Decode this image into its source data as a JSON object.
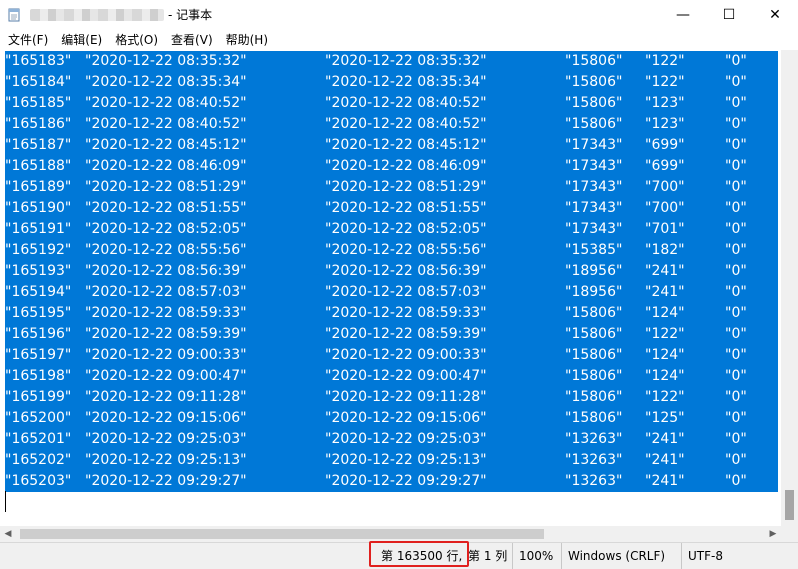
{
  "window": {
    "title": "- 记事本",
    "minimize_glyph": "—",
    "maximize_glyph": "☐",
    "close_glyph": "✕"
  },
  "menu": [
    {
      "label": "文件(F)"
    },
    {
      "label": "编辑(E)"
    },
    {
      "label": "格式(O)"
    },
    {
      "label": "查看(V)"
    },
    {
      "label": "帮助(H)"
    }
  ],
  "rows": [
    [
      "\"165183\"",
      "\"2020-12-22 08:35:32\"",
      "\"2020-12-22 08:35:32\"",
      "\"15806\"",
      "\"122\"",
      "\"0\""
    ],
    [
      "\"165184\"",
      "\"2020-12-22 08:35:34\"",
      "\"2020-12-22 08:35:34\"",
      "\"15806\"",
      "\"122\"",
      "\"0\""
    ],
    [
      "\"165185\"",
      "\"2020-12-22 08:40:52\"",
      "\"2020-12-22 08:40:52\"",
      "\"15806\"",
      "\"123\"",
      "\"0\""
    ],
    [
      "\"165186\"",
      "\"2020-12-22 08:40:52\"",
      "\"2020-12-22 08:40:52\"",
      "\"15806\"",
      "\"123\"",
      "\"0\""
    ],
    [
      "\"165187\"",
      "\"2020-12-22 08:45:12\"",
      "\"2020-12-22 08:45:12\"",
      "\"17343\"",
      "\"699\"",
      "\"0\""
    ],
    [
      "\"165188\"",
      "\"2020-12-22 08:46:09\"",
      "\"2020-12-22 08:46:09\"",
      "\"17343\"",
      "\"699\"",
      "\"0\""
    ],
    [
      "\"165189\"",
      "\"2020-12-22 08:51:29\"",
      "\"2020-12-22 08:51:29\"",
      "\"17343\"",
      "\"700\"",
      "\"0\""
    ],
    [
      "\"165190\"",
      "\"2020-12-22 08:51:55\"",
      "\"2020-12-22 08:51:55\"",
      "\"17343\"",
      "\"700\"",
      "\"0\""
    ],
    [
      "\"165191\"",
      "\"2020-12-22 08:52:05\"",
      "\"2020-12-22 08:52:05\"",
      "\"17343\"",
      "\"701\"",
      "\"0\""
    ],
    [
      "\"165192\"",
      "\"2020-12-22 08:55:56\"",
      "\"2020-12-22 08:55:56\"",
      "\"15385\"",
      "\"182\"",
      "\"0\""
    ],
    [
      "\"165193\"",
      "\"2020-12-22 08:56:39\"",
      "\"2020-12-22 08:56:39\"",
      "\"18956\"",
      "\"241\"",
      "\"0\""
    ],
    [
      "\"165194\"",
      "\"2020-12-22 08:57:03\"",
      "\"2020-12-22 08:57:03\"",
      "\"18956\"",
      "\"241\"",
      "\"0\""
    ],
    [
      "\"165195\"",
      "\"2020-12-22 08:59:33\"",
      "\"2020-12-22 08:59:33\"",
      "\"15806\"",
      "\"124\"",
      "\"0\""
    ],
    [
      "\"165196\"",
      "\"2020-12-22 08:59:39\"",
      "\"2020-12-22 08:59:39\"",
      "\"15806\"",
      "\"122\"",
      "\"0\""
    ],
    [
      "\"165197\"",
      "\"2020-12-22 09:00:33\"",
      "\"2020-12-22 09:00:33\"",
      "\"15806\"",
      "\"124\"",
      "\"0\""
    ],
    [
      "\"165198\"",
      "\"2020-12-22 09:00:47\"",
      "\"2020-12-22 09:00:47\"",
      "\"15806\"",
      "\"124\"",
      "\"0\""
    ],
    [
      "\"165199\"",
      "\"2020-12-22 09:11:28\"",
      "\"2020-12-22 09:11:28\"",
      "\"15806\"",
      "\"122\"",
      "\"0\""
    ],
    [
      "\"165200\"",
      "\"2020-12-22 09:15:06\"",
      "\"2020-12-22 09:15:06\"",
      "\"15806\"",
      "\"125\"",
      "\"0\""
    ],
    [
      "\"165201\"",
      "\"2020-12-22 09:25:03\"",
      "\"2020-12-22 09:25:03\"",
      "\"13263\"",
      "\"241\"",
      "\"0\""
    ],
    [
      "\"165202\"",
      "\"2020-12-22 09:25:13\"",
      "\"2020-12-22 09:25:13\"",
      "\"13263\"",
      "\"241\"",
      "\"0\""
    ],
    [
      "\"165203\"",
      "\"2020-12-22 09:29:27\"",
      "\"2020-12-22 09:29:27\"",
      "\"13263\"",
      "\"241\"",
      "\"0\""
    ]
  ],
  "status": {
    "position_line": "第 163500 行,",
    "position_col": "第 1 列",
    "zoom": "100%",
    "line_ending": "Windows (CRLF)",
    "encoding": "UTF-8"
  },
  "colors": {
    "selection": "#0078d7",
    "highlight_box": "#e0201e"
  }
}
